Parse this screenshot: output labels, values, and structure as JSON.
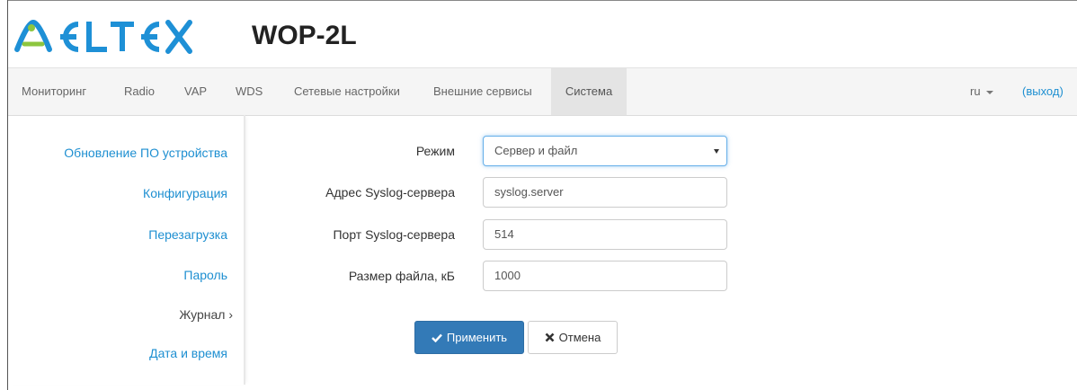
{
  "header": {
    "brand": "ELTEX",
    "device_title": "WOP-2L",
    "brand_color": "#1e90d6",
    "brand_accent": "#8dc63f"
  },
  "navbar": {
    "items": [
      {
        "label": "Мониторинг"
      },
      {
        "label": "Radio"
      },
      {
        "label": "VAP"
      },
      {
        "label": "WDS"
      },
      {
        "label": "Сетевые настройки"
      },
      {
        "label": "Внешние сервисы"
      },
      {
        "label": "Система",
        "active": true
      }
    ],
    "language": "ru",
    "logout": "(выход)"
  },
  "sidebar": {
    "items": [
      {
        "label": "Обновление ПО устройства"
      },
      {
        "label": "Конфигурация"
      },
      {
        "label": "Перезагрузка"
      },
      {
        "label": "Пароль"
      },
      {
        "label": "Журнал ›",
        "current": true
      },
      {
        "label": "Дата и время"
      }
    ]
  },
  "form": {
    "mode": {
      "label": "Режим",
      "value": "Сервер и файл"
    },
    "syslog_address": {
      "label": "Адрес Syslog-сервера",
      "value": "syslog.server"
    },
    "syslog_port": {
      "label": "Порт Syslog-сервера",
      "value": "514"
    },
    "file_size": {
      "label": "Размер файла, кБ",
      "value": "1000"
    }
  },
  "buttons": {
    "apply": "Применить",
    "cancel": "Отмена"
  }
}
